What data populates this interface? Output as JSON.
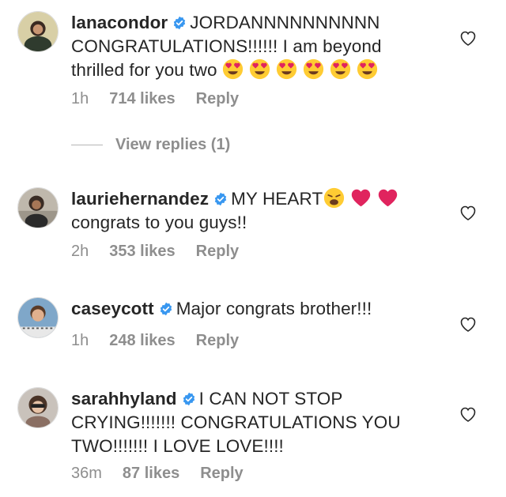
{
  "comments": [
    {
      "username": "lanacondor",
      "lines": [
        "JORDANNNNNNNNNN",
        "CONGRATULATIONS!!!!!! I am beyond",
        "thrilled for you two"
      ],
      "emoji_icons": [
        "heart-eyes-emoji",
        "heart-eyes-emoji",
        "heart-eyes-emoji",
        "heart-eyes-emoji",
        "heart-eyes-emoji",
        "heart-eyes-emoji"
      ],
      "time": "1h",
      "likes": "714 likes",
      "reply": "Reply"
    },
    {
      "username": "lauriehernandez",
      "lines": [
        "MY HEART",
        "congrats to you guys!!"
      ],
      "emoji_icons": [
        "weary-face-emoji",
        "red-heart-emoji",
        "red-heart-emoji"
      ],
      "time": "2h",
      "likes": "353 likes",
      "reply": "Reply"
    },
    {
      "username": "caseycott",
      "lines": [
        "Major congrats brother!!!"
      ],
      "time": "1h",
      "likes": "248 likes",
      "reply": "Reply"
    },
    {
      "username": "sarahhyland",
      "lines": [
        "I CAN NOT STOP",
        "CRYING!!!!!!! CONGRATULATIONS YOU",
        "TWO!!!!!!! I LOVE LOVE!!!!"
      ],
      "time": "36m",
      "likes": "87 likes",
      "reply": "Reply"
    }
  ],
  "view_replies": "View replies (1)",
  "colors": {
    "text": "#262626",
    "meta": "#8e8e8e",
    "verified": "#3897f0",
    "emoji_heart": "#e0245e"
  },
  "icons": {
    "verified": "verified-badge-icon",
    "like": "heart-outline-icon"
  }
}
